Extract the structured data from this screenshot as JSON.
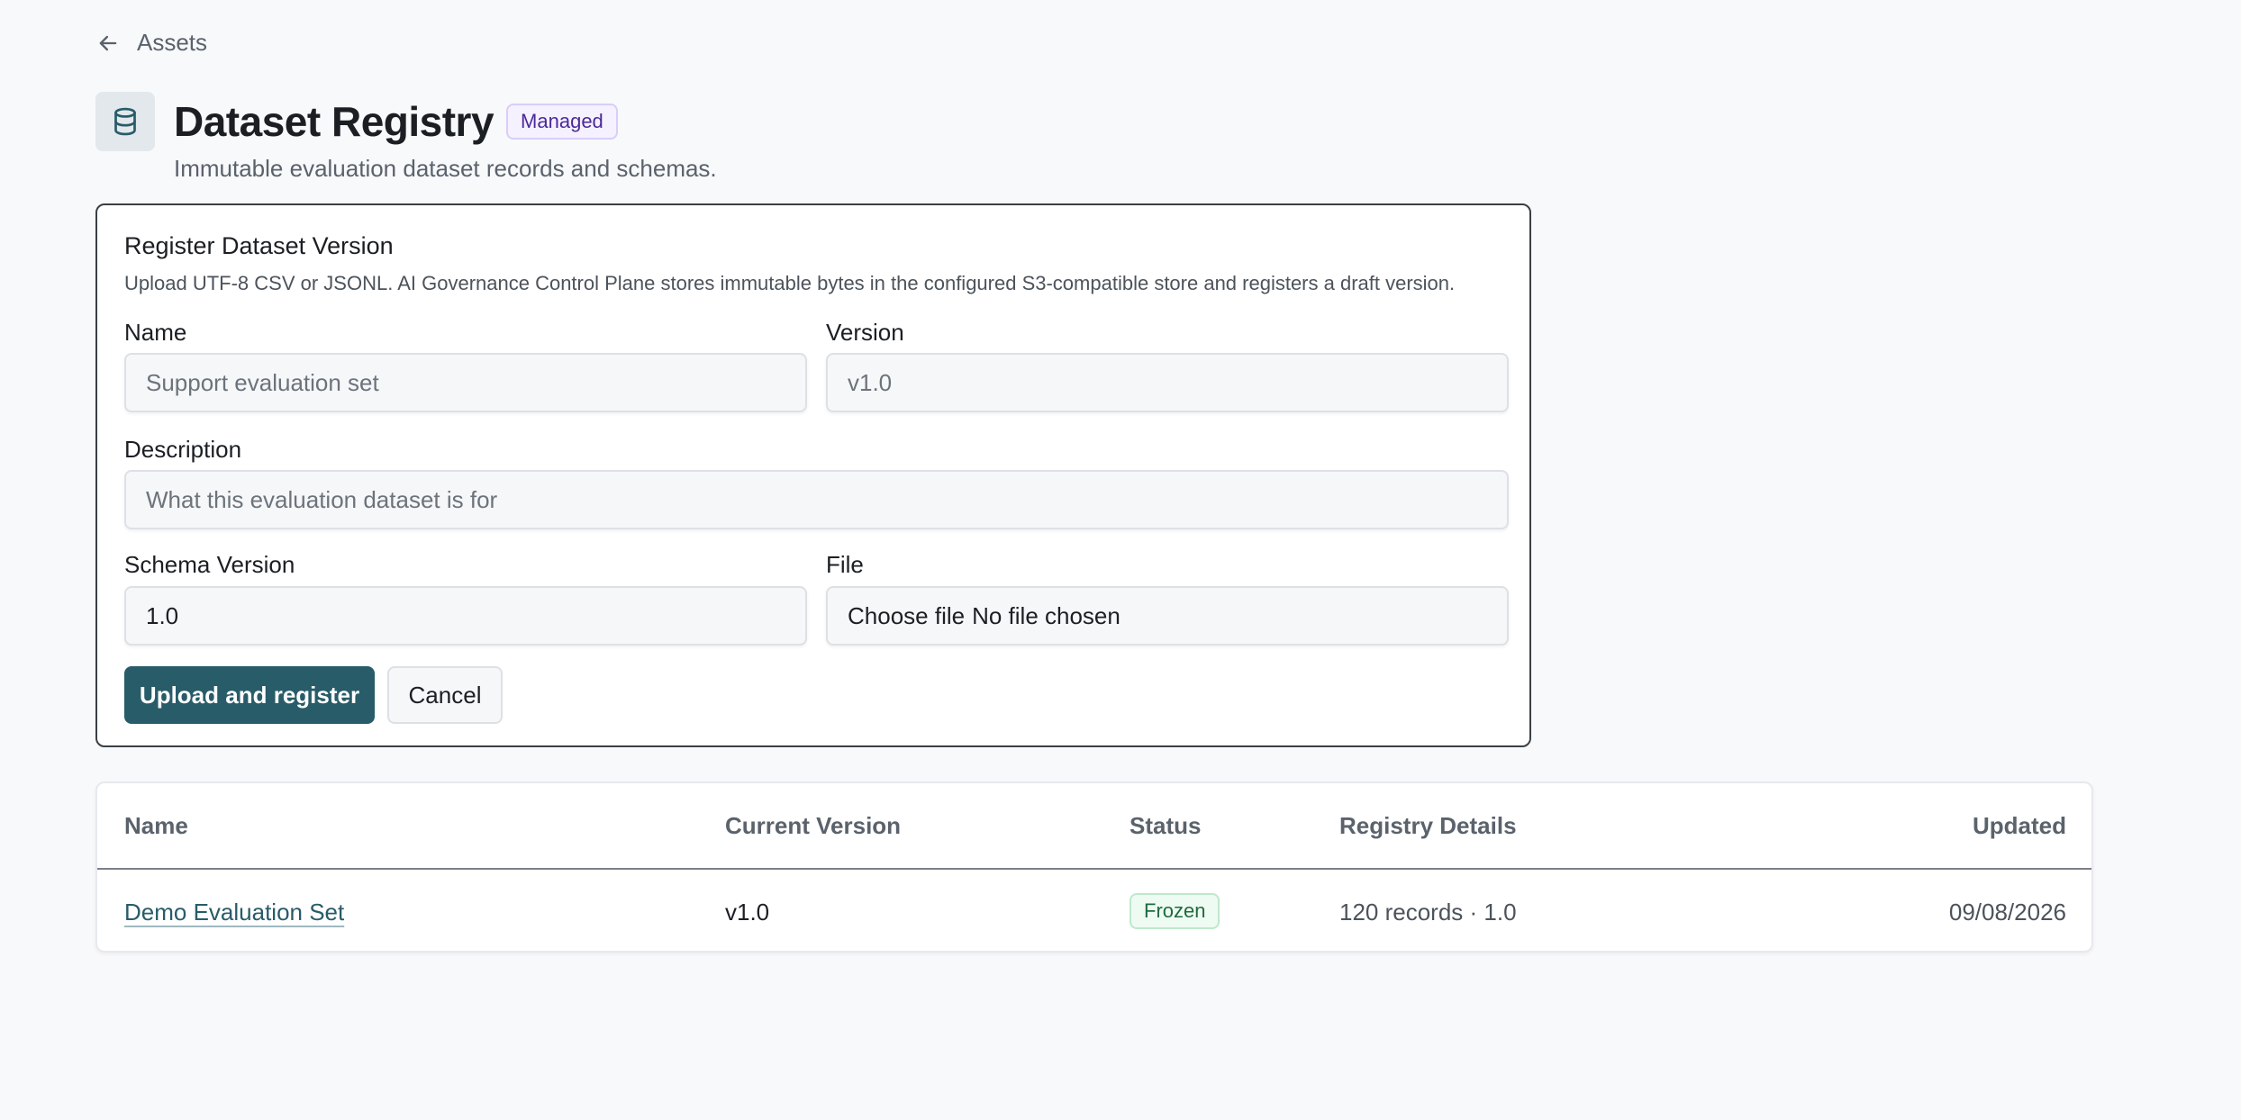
{
  "nav": {
    "back_label": "Assets",
    "back_icon": "arrow-left-icon"
  },
  "header": {
    "icon": "database-icon",
    "title": "Dataset Registry",
    "badge": "Managed",
    "subtitle": "Immutable evaluation dataset records and schemas."
  },
  "form": {
    "title": "Register Dataset Version",
    "help": "Upload UTF-8 CSV or JSONL. AI Governance Control Plane stores immutable bytes in the configured S3-compatible store and registers a draft version.",
    "name": {
      "label": "Name",
      "placeholder": "Support evaluation set",
      "value": ""
    },
    "version": {
      "label": "Version",
      "placeholder": "v1.0",
      "value": ""
    },
    "description": {
      "label": "Description",
      "placeholder": "What this evaluation dataset is for",
      "value": ""
    },
    "schema_version": {
      "label": "Schema Version",
      "value": "1.0"
    },
    "file": {
      "label": "File",
      "button": "Choose file",
      "status": "No file chosen"
    },
    "submit_label": "Upload and register",
    "cancel_label": "Cancel"
  },
  "table": {
    "columns": [
      "Name",
      "Current Version",
      "Status",
      "Registry Details",
      "Updated"
    ],
    "rows": [
      {
        "name": "Demo Evaluation Set",
        "current_version": "v1.0",
        "status": "Frozen",
        "details": "120 records · 1.0",
        "updated": "09/08/2026"
      }
    ]
  },
  "colors": {
    "primary": "#285c69",
    "managed_badge": "#4b2a9b",
    "frozen_badge": "#1f6b3e",
    "background": "#f8f9fb"
  }
}
